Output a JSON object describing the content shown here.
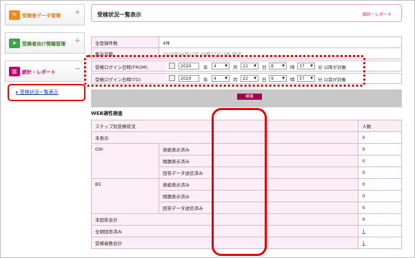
{
  "sidebar": {
    "items": [
      {
        "label": "受検者データ管理",
        "icon": "document-pencil-icon",
        "color": "#f08a1c"
      },
      {
        "label": "受検者向け情報管理",
        "icon": "send-plane-icon",
        "color": "#3fa34d"
      },
      {
        "label": "統計・レポート",
        "icon": "chart-icon",
        "color": "#c2006d"
      }
    ],
    "sub_link": "▸ 受検状況一覧表示"
  },
  "header": {
    "title": "受検状況一覧表示",
    "right_label": "統計・レポート"
  },
  "info": {
    "total_label": "全登録件数",
    "total_value": "4件",
    "aggregate_label": "集計日時",
    "aggregate_value": "2020年04月22日 09時37分10秒 時点"
  },
  "filter": {
    "from": {
      "label": "受検ログイン日時(FROM)",
      "year": "2020",
      "month": "4",
      "day": "22",
      "hour": "8",
      "minute": "37",
      "suffix": "分 以降が対象"
    },
    "to": {
      "label": "受検ログイン日時(TO)",
      "year": "2020",
      "month": "4",
      "day": "22",
      "hour": "9",
      "minute": "37",
      "suffix": "分 以前が対象"
    },
    "units": {
      "year": "年",
      "month": "月",
      "day": "日",
      "hour": "時"
    },
    "search_label": "検索"
  },
  "web": {
    "section_title": "WEB適性検査",
    "col_status": "ステップ別受検状況",
    "col_count": "人数",
    "rows": {
      "not_shown": {
        "label": "未表示",
        "value": "0"
      },
      "g9r": {
        "label": "G9r",
        "sub": [
          {
            "label": "表紙表示済み",
            "value": "0"
          },
          {
            "label": "問題表示済み",
            "value": "0"
          },
          {
            "label": "回答データ送信済み",
            "value": "0"
          }
        ]
      },
      "b5": {
        "label": "B5",
        "sub": [
          {
            "label": "表紙表示済み",
            "value": "0"
          },
          {
            "label": "問題表示済み",
            "value": "0"
          },
          {
            "label": "回答データ送信済み",
            "value": "0"
          }
        ]
      },
      "unanswered_total": {
        "label": "未回答合計",
        "value": "0"
      },
      "all_answered": {
        "label": "全問回答済み",
        "value": "1"
      },
      "examinee_total": {
        "label": "受検者数合計",
        "value": "1"
      }
    }
  }
}
